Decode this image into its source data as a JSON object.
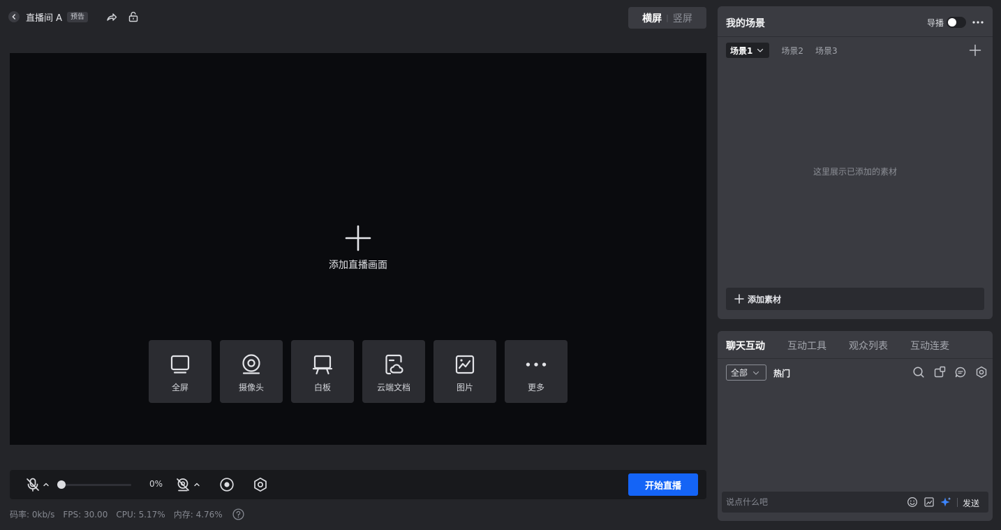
{
  "header": {
    "room_title": "直播间 A",
    "badge": "预告",
    "orientation": {
      "active": "横屏",
      "inactive": "竖屏"
    }
  },
  "preview": {
    "add_label": "添加直播画面",
    "sources": [
      {
        "label": "全屏",
        "icon": "monitor-icon"
      },
      {
        "label": "摄像头",
        "icon": "webcam-icon"
      },
      {
        "label": "白板",
        "icon": "whiteboard-icon"
      },
      {
        "label": "云端文档",
        "icon": "cloud-document-icon"
      },
      {
        "label": "图片",
        "icon": "image-icon"
      },
      {
        "label": "更多",
        "icon": "more-dots-icon"
      }
    ]
  },
  "controls": {
    "volume_level": 0,
    "volume_text": "0%",
    "start_label": "开始直播"
  },
  "stats": {
    "bitrate": "码率: 0kb/s",
    "fps": "FPS: 30.00",
    "cpu": "CPU: 5.17%",
    "memory": "内存: 4.76%"
  },
  "scenes": {
    "title": "我的场景",
    "director_label": "导播",
    "director_on": false,
    "tabs": [
      "场景1",
      "场景2",
      "场景3"
    ],
    "empty_text": "这里展示已添加的素材",
    "add_material": "添加素材"
  },
  "chat": {
    "tabs": [
      "聊天互动",
      "互动工具",
      "观众列表",
      "互动连麦"
    ],
    "filter": "全部",
    "hot": "热门",
    "input_placeholder": "说点什么吧",
    "send": "发送"
  },
  "colors": {
    "accent": "#1464f6",
    "preview_bg": "#0a0b0e",
    "panel_bg": "#3a3b41",
    "page_bg": "#242529"
  }
}
